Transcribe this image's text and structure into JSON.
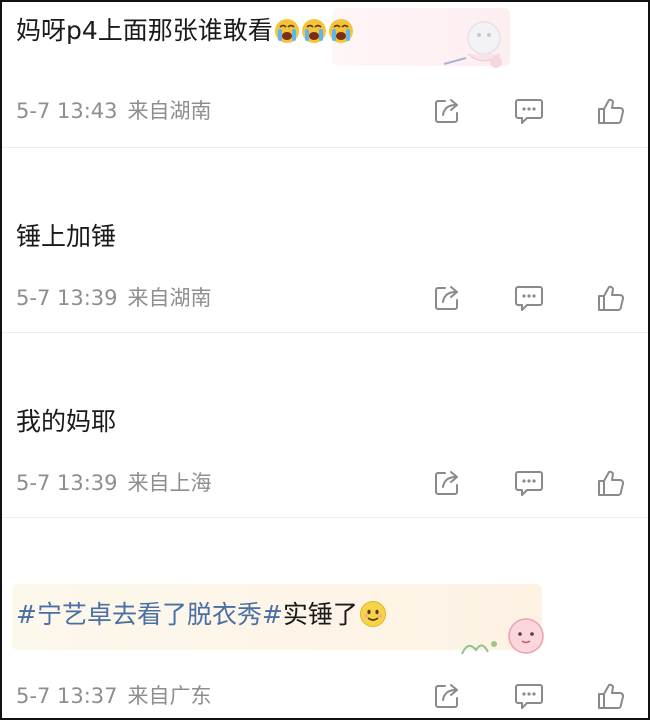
{
  "comments": [
    {
      "text": "妈呀p4上面那张谁敢看",
      "emoji": "loudly-crying-face",
      "emoji_count": 3,
      "time": "5-7 13:43",
      "location": "来自湖南"
    },
    {
      "text": "锤上加锤",
      "time": "5-7 13:39",
      "location": "来自湖南"
    },
    {
      "text": "我的妈耶",
      "time": "5-7 13:39",
      "location": "来自上海"
    },
    {
      "hashtag": "#宁艺卓去看了脱衣秀#",
      "text": "实锤了",
      "emoji": "smiling-face",
      "time": "5-7 13:37",
      "location": "来自广东"
    }
  ],
  "icons": {
    "share": "share-icon",
    "comment": "comment-bubble-icon",
    "like": "thumbs-up-icon"
  },
  "colors": {
    "text": "#1a1a1a",
    "meta": "#8e8e8e",
    "hashtag": "#4a6fa5",
    "icon": "#8a8a8a"
  }
}
